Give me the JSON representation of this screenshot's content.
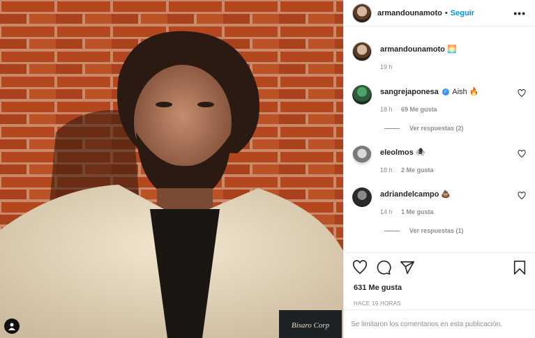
{
  "header": {
    "username": "armandounamoto",
    "separator": "•",
    "follow_label": "Seguir",
    "more_icon": "more-horizontal-icon"
  },
  "caption": {
    "username": "armandounamoto",
    "text": "🌅",
    "time": "19 h"
  },
  "comments": [
    {
      "username": "sangrejaponesa",
      "verified": true,
      "text": "Aish 🔥",
      "time": "18 h",
      "likes": "69 Me gusta",
      "replies": "Ver respuestas (2)"
    },
    {
      "username": "eleolmos",
      "verified": false,
      "text": "🕷",
      "time": "18 h",
      "likes": "2 Me gusta",
      "replies": ""
    },
    {
      "username": "adriandelcampo",
      "verified": false,
      "text": "💩",
      "time": "14 h",
      "likes": "1 Me gusta",
      "replies": "Ver respuestas (1)"
    }
  ],
  "actions": {
    "like_icon": "heart-icon",
    "comment_icon": "comment-icon",
    "share_icon": "share-icon",
    "save_icon": "bookmark-icon",
    "likes_count": "631 Me gusta",
    "posted_ago": "HACE 19 HORAS"
  },
  "footer": {
    "comments_limited": "Se limitaron los comentarios en esta publicación."
  },
  "colors": {
    "accent": "#0095f6",
    "muted": "#8e8e8e",
    "brick": "#b24a22"
  }
}
